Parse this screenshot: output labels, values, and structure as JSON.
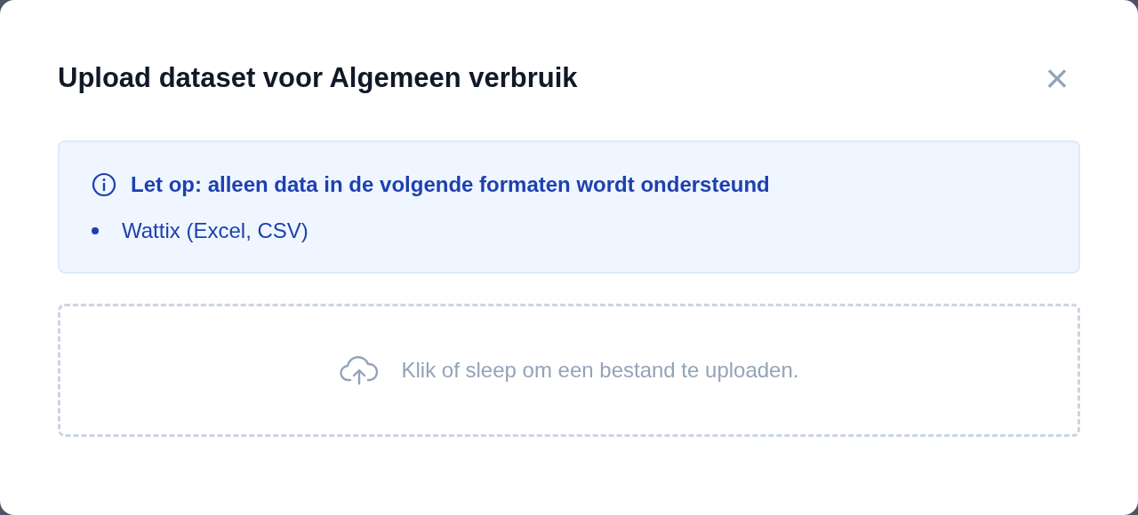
{
  "dialog": {
    "title": "Upload dataset voor Algemeen verbruik",
    "close": "×"
  },
  "notice": {
    "heading": "Let op: alleen data in de volgende formaten wordt ondersteund",
    "items": [
      "Wattix (Excel, CSV)"
    ]
  },
  "dropzone": {
    "text": "Klik of sleep om een bestand te uploaden."
  }
}
